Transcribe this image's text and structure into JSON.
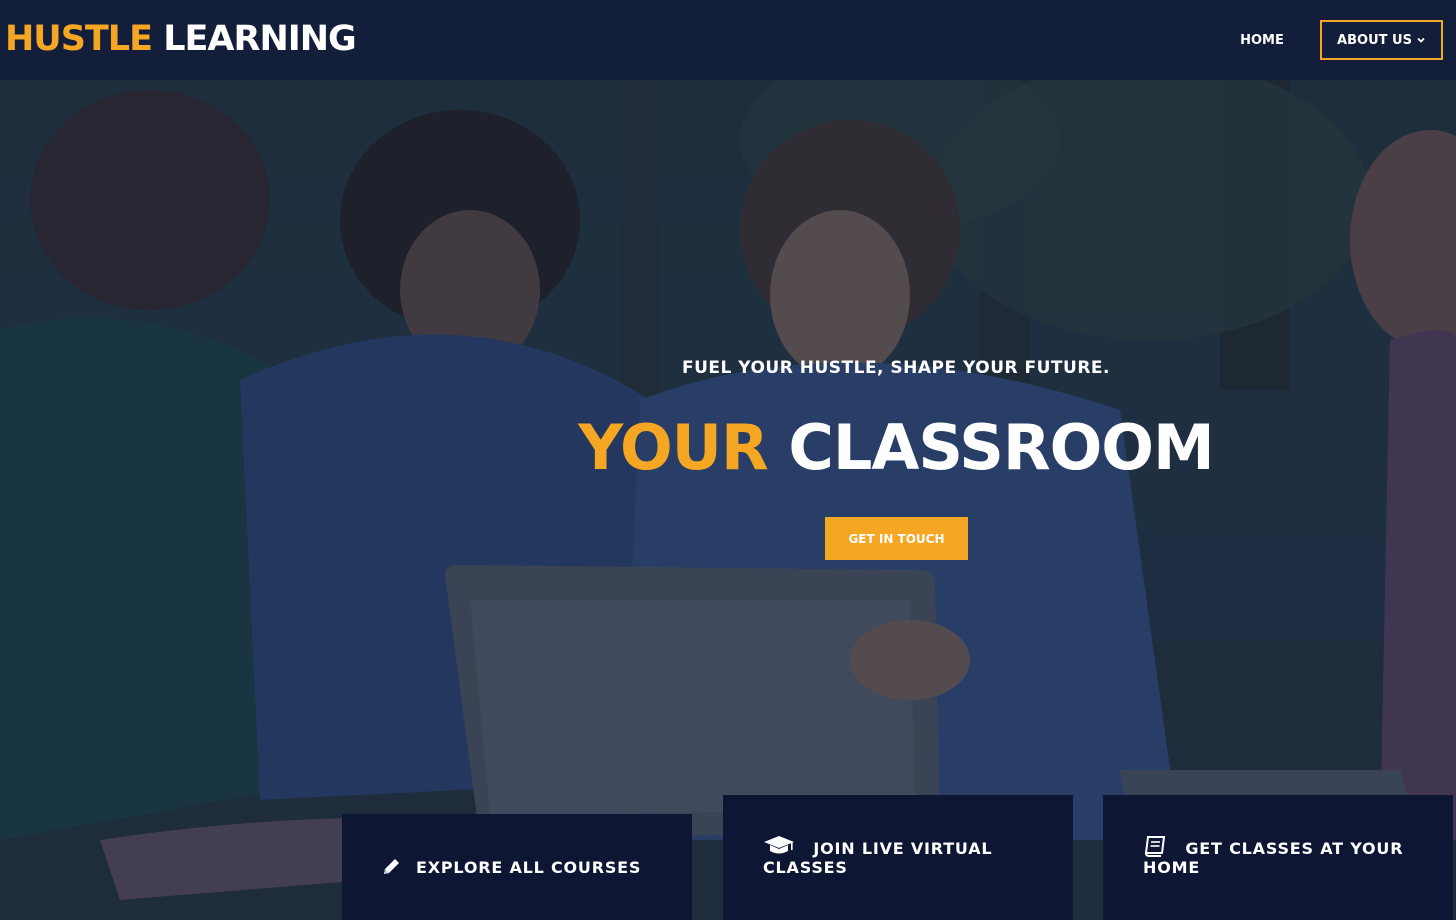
{
  "header": {
    "logo_accent": "HUSTLE",
    "logo_plain": "LEARNING",
    "nav": {
      "home": "HOME",
      "about": "ABOUT US"
    }
  },
  "hero": {
    "tagline": "FUEL YOUR HUSTLE, SHAPE YOUR FUTURE.",
    "headline_accent": "YOUR",
    "headline_plain": "CLASSROOM",
    "cta": "GET IN TOUCH"
  },
  "cards": [
    {
      "icon": "pencil-icon",
      "label": "EXPLORE ALL COURSES"
    },
    {
      "icon": "graduation-cap-icon",
      "label": "JOIN LIVE VIRTUAL CLASSES"
    },
    {
      "icon": "book-icon",
      "label": "GET CLASSES AT YOUR HOME"
    }
  ],
  "colors": {
    "accent": "#f5a623",
    "header_bg": "#131e3a",
    "card_bg": "#0d1633",
    "text": "#ffffff"
  }
}
